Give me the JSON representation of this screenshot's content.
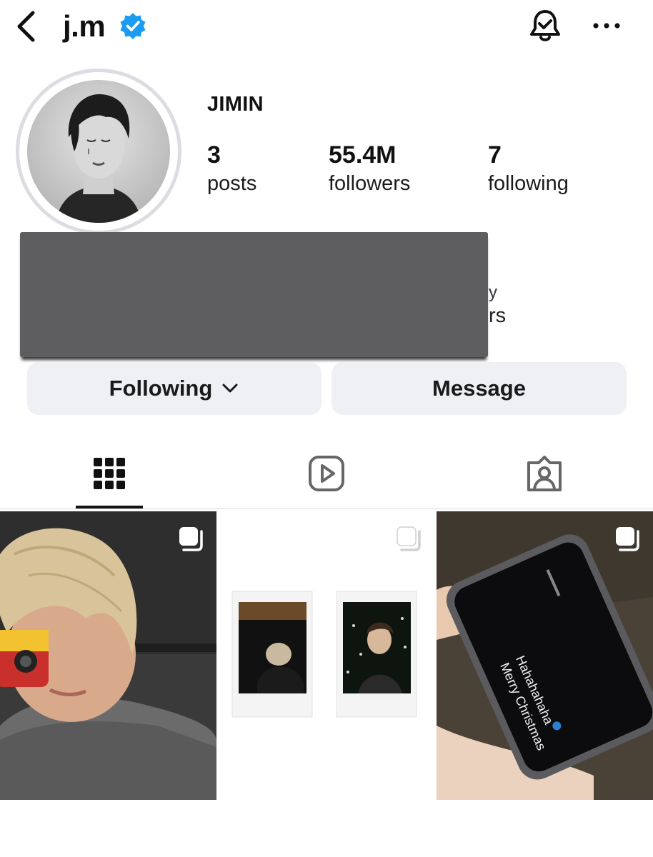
{
  "header": {
    "username": "j.m",
    "back_icon": "chevron-left-icon",
    "verified_icon": "verified-badge-icon",
    "bell_icon": "bell-check-icon",
    "more_icon": "more-horizontal-icon",
    "verified_color": "#1d9bf0"
  },
  "profile": {
    "display_name": "JIMIN",
    "stats": [
      {
        "value": "3",
        "label": "posts"
      },
      {
        "value": "55.4M",
        "label": "followers"
      },
      {
        "value": "7",
        "label": "following"
      }
    ],
    "bio_redacted": true,
    "bio_peek": [
      "y",
      "rs"
    ]
  },
  "actions": {
    "following_label": "Following",
    "message_label": "Message"
  },
  "tabs": [
    {
      "icon": "grid-icon",
      "active": true
    },
    {
      "icon": "reels-icon",
      "active": false
    },
    {
      "icon": "tagged-icon",
      "active": false
    }
  ],
  "posts": [
    {
      "kind": "multi-photo-icon",
      "description_icon": "selfie-camera"
    },
    {
      "kind": "multi-photo-icon",
      "description_icon": "polaroids"
    },
    {
      "kind": "multi-photo-icon",
      "description_icon": "phone-message",
      "message_text": [
        "Merry Christmas",
        "Hahahahaha"
      ]
    }
  ]
}
